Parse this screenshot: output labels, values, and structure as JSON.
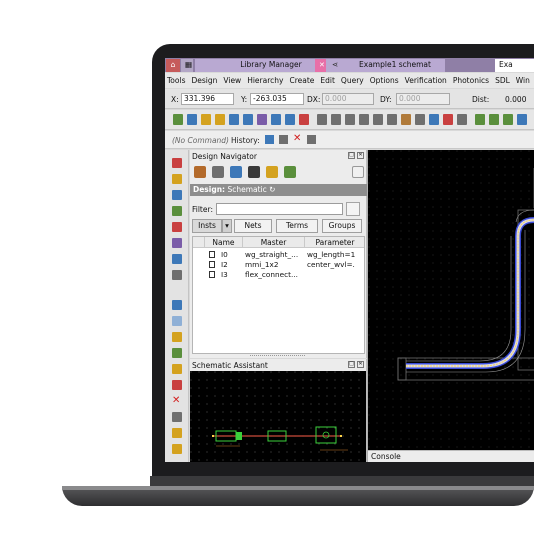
{
  "tabs": {
    "library_manager": "Library Manager",
    "example_schematic": "Example1 schemat",
    "partial_tab": "Exa"
  },
  "menu": [
    "Tools",
    "Design",
    "View",
    "Hierarchy",
    "Create",
    "Edit",
    "Query",
    "Options",
    "Verification",
    "Photonics",
    "SDL",
    "Win"
  ],
  "coords": {
    "x_label": "X:",
    "x_value": "331.396",
    "y_label": "Y:",
    "y_value": "-263.035",
    "dx_label": "DX:",
    "dx_value": "0.000",
    "dy_label": "DY:",
    "dy_value": "0.000",
    "dist_label": "Dist:",
    "dist_value": "0.000"
  },
  "command": {
    "placeholder": "(No Command)",
    "history_label": "History:"
  },
  "navigator": {
    "title": "Design Navigator",
    "design_label": "Design:",
    "design_value": "Schematic",
    "filter_label": "Filter:",
    "tabs": [
      "Insts",
      "Nets",
      "Terms",
      "Groups"
    ],
    "columns": [
      "Name",
      "Master",
      "Parameter"
    ],
    "rows": [
      {
        "name": "I0",
        "master": "wg_straight_...",
        "parameter": "wg_length=1"
      },
      {
        "name": "I2",
        "master": "mmi_1x2",
        "parameter": "center_wvl=."
      },
      {
        "name": "I3",
        "master": "flex_connect...",
        "parameter": ""
      }
    ]
  },
  "assistant": {
    "title": "Schematic Assistant"
  },
  "console": {
    "label": "Console"
  },
  "colors": {
    "tab_bar": "#8f7fa6",
    "canvas": "#000000",
    "waveguide_outline": "#3a4bd8",
    "waveguide_core": "#ffffff",
    "highlight": "#ffd54a",
    "grid_dots": "#3a3a3a"
  },
  "icons": {
    "home": "home-icon",
    "close": "close-icon",
    "share": "share-icon"
  }
}
